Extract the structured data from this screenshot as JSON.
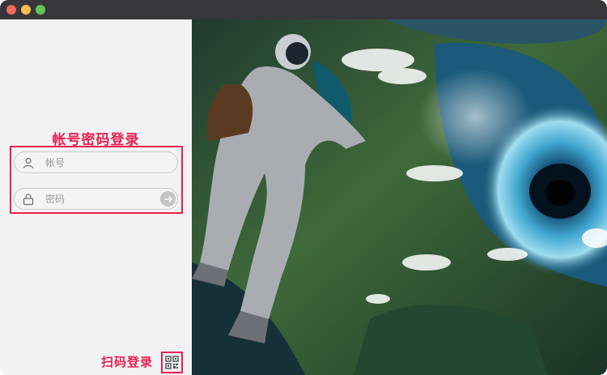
{
  "window": {
    "traffic_lights": [
      "close",
      "minimize",
      "maximize"
    ]
  },
  "login": {
    "title": "帐号密码登录",
    "username_placeholder": "帐号",
    "password_placeholder": "密码",
    "username_icon": "user-icon",
    "password_icon": "lock-icon",
    "submit_icon": "arrow-right-icon"
  },
  "qr_login": {
    "label": "扫码登录",
    "icon": "qr-code-icon"
  },
  "colors": {
    "accent": "#e8214f",
    "panel_bg": "#f2f1f4",
    "titlebar": "#38363a"
  },
  "hero": {
    "image": "astronaut-over-vortex-illustration"
  }
}
